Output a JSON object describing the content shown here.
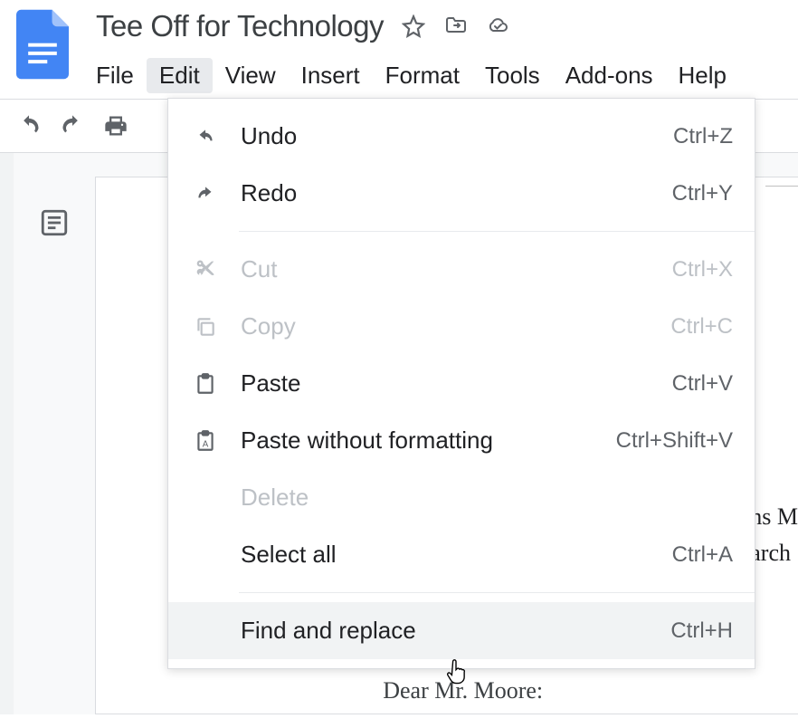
{
  "document": {
    "title": "Tee Off for Technology"
  },
  "menubar": {
    "items": [
      "File",
      "Edit",
      "View",
      "Insert",
      "Format",
      "Tools",
      "Add-ons",
      "Help"
    ],
    "active_index": 1
  },
  "dropdown": {
    "items": [
      {
        "icon": "undo-icon",
        "label": "Undo",
        "shortcut": "Ctrl+Z",
        "disabled": false
      },
      {
        "icon": "redo-icon",
        "label": "Redo",
        "shortcut": "Ctrl+Y",
        "disabled": false
      },
      {
        "separator": true
      },
      {
        "icon": "cut-icon",
        "label": "Cut",
        "shortcut": "Ctrl+X",
        "disabled": true
      },
      {
        "icon": "copy-icon",
        "label": "Copy",
        "shortcut": "Ctrl+C",
        "disabled": true
      },
      {
        "icon": "paste-icon",
        "label": "Paste",
        "shortcut": "Ctrl+V",
        "disabled": false
      },
      {
        "icon": "paste-plain-icon",
        "label": "Paste without formatting",
        "shortcut": "Ctrl+Shift+V",
        "disabled": false
      },
      {
        "icon": "",
        "label": "Delete",
        "shortcut": "",
        "disabled": true
      },
      {
        "icon": "",
        "label": "Select all",
        "shortcut": "Ctrl+A",
        "disabled": false
      },
      {
        "separator": true
      },
      {
        "icon": "",
        "label": "Find and replace",
        "shortcut": "Ctrl+H",
        "disabled": false,
        "hover": true
      }
    ]
  },
  "page_text": {
    "line1": "ns M",
    "line2": "arch",
    "bottom": "Dear Mr. Moore:"
  }
}
